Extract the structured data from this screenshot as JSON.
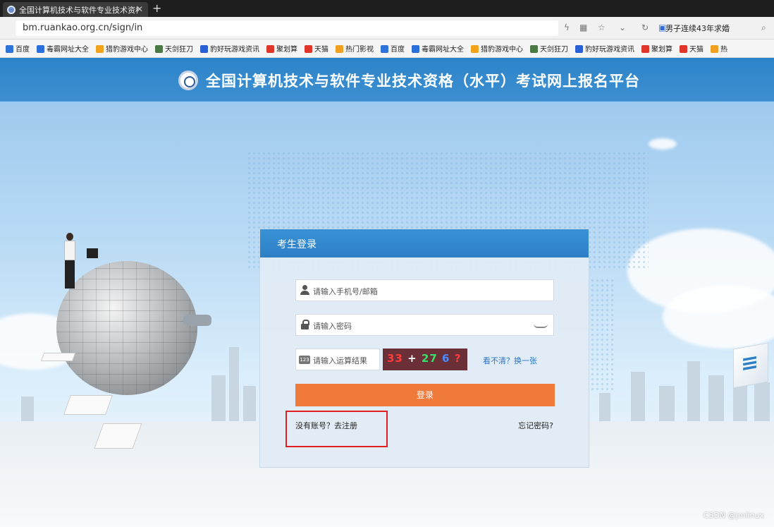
{
  "browser": {
    "tab_title": "全国计算机技术与软件专业技术资格",
    "url": "bm.ruankao.org.cn/sign/in",
    "search_hint": "男子连续43年求婚",
    "bookmarks": [
      {
        "label": "百度",
        "color": "#2d73d9"
      },
      {
        "label": "毒霸网址大全",
        "color": "#2a6fdc"
      },
      {
        "label": "猎豹游戏中心",
        "color": "#f2a21b"
      },
      {
        "label": "天剑狂刀",
        "color": "#4b7a44"
      },
      {
        "label": "豹好玩游戏资讯",
        "color": "#2a5fd6"
      },
      {
        "label": "聚划算",
        "color": "#e0352b"
      },
      {
        "label": "天猫",
        "color": "#e0352b"
      },
      {
        "label": "热门影视",
        "color": "#f0a020"
      },
      {
        "label": "百度",
        "color": "#2d73d9"
      },
      {
        "label": "毒霸网址大全",
        "color": "#2a6fdc"
      },
      {
        "label": "猎豹游戏中心",
        "color": "#f2a21b"
      },
      {
        "label": "天剑狂刀",
        "color": "#4b7a44"
      },
      {
        "label": "豹好玩游戏资讯",
        "color": "#2a5fd6"
      },
      {
        "label": "聚划算",
        "color": "#e0352b"
      },
      {
        "label": "天猫",
        "color": "#e0352b"
      },
      {
        "label": "热",
        "color": "#f0a020"
      }
    ]
  },
  "header": {
    "title": "全国计算机技术与软件专业技术资格（水平）考试网上报名平台"
  },
  "login": {
    "heading": "考生登录",
    "username_placeholder": "请输入手机号/邮箱",
    "password_placeholder": "请输入密码",
    "captcha_placeholder": "请输入运算结果",
    "captcha_icon_text": "123",
    "captcha_text": {
      "a": "33",
      "op": "+",
      "b": "27",
      "c": "6",
      "d": "?"
    },
    "refresh_link": "看不清？换一张",
    "submit_label": "登录",
    "register_link": "没有账号？去注册",
    "forgot_link": "忘记密码?"
  },
  "watermark": "CSDN @jmlinux"
}
